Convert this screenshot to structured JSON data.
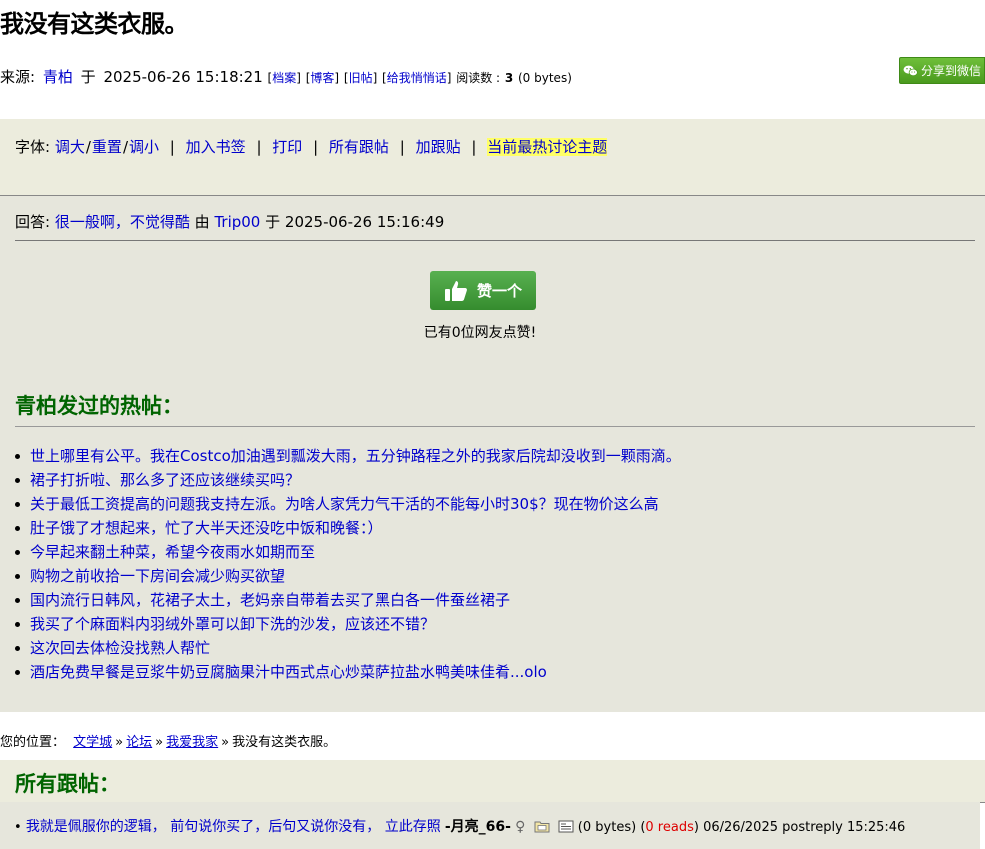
{
  "post": {
    "title": "我没有这类衣服。",
    "source_label": "来源:",
    "author": "青柏",
    "at_word": "于",
    "datetime": "2025-06-26 15:18:21",
    "links": [
      "档案",
      "博客",
      "旧帖",
      "给我悄悄话"
    ],
    "reads_label": "阅读数 :",
    "reads": "3",
    "size": "(0 bytes)"
  },
  "share": {
    "label": "分享到微信",
    "icon": "wechat-icon"
  },
  "toolbar": {
    "font_label": "字体:",
    "bigger": "调大",
    "reset": "重置",
    "smaller": "调小",
    "bookmark": "加入书签",
    "print": "打印",
    "all_followups": "所有跟帖",
    "add_followup": "加跟贴",
    "hottest": "当前最热讨论主题",
    "separator": "|",
    "slash": "/"
  },
  "reply": {
    "label": "回答:",
    "subject": "很一般啊，不觉得酷",
    "by_word": "由",
    "author": "Trip00",
    "at_word": "于",
    "datetime": "2025-06-26 15:16:49"
  },
  "like": {
    "button_label": "赞一个",
    "icon": "thumbs-up-icon",
    "count_text": "已有0位网友点赞!"
  },
  "hot_posts": {
    "title": "青柏发过的热帖：",
    "items": [
      "世上哪里有公平。我在Costco加油遇到瓢泼大雨，五分钟路程之外的我家后院却没收到一颗雨滴。",
      "裙子打折啦、那么多了还应该继续买吗？",
      "关于最低工资提高的问题我支持左派。为啥人家凭力气干活的不能每小时30$？现在物价这么高",
      "肚子饿了才想起来，忙了大半天还没吃中饭和晚餐：）",
      "今早起来翻土种菜，希望今夜雨水如期而至",
      "购物之前收拾一下房间会减少购买欲望",
      "国内流行日韩风，花裙子太土，老妈亲自带着去买了黑白各一件蚕丝裙子",
      "我买了个麻面料内羽绒外罩可以卸下洗的沙发，应该还不错？",
      "这次回去体检没找熟人帮忙",
      "酒店免费早餐是豆浆牛奶豆腐脑果汁中西式点心炒菜萨拉盐水鸭美味佳肴...olo"
    ]
  },
  "breadcrumb": {
    "label": "您的位置：",
    "items": [
      "文学城",
      "论坛",
      "我爱我家"
    ],
    "current": "我没有这类衣服。",
    "raquo": "»"
  },
  "followups": {
    "title": "所有跟帖：",
    "items": [
      {
        "bullet": "•",
        "subject": "我就是佩服你的逻辑， 前句说你买了，后句又说你没有， 立此存照",
        "author": "-月亮_66-",
        "gender_symbol": "♀",
        "size": "(0 bytes)",
        "reads_open": "(",
        "reads": "0 reads",
        "reads_close": ")",
        "datetime": "06/26/2025 postreply 15:25:46"
      }
    ]
  }
}
